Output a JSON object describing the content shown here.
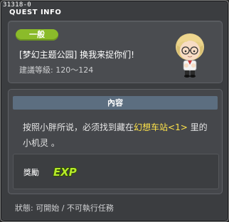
{
  "window": {
    "quest_id": "31318-0",
    "title": "QUEST INFO"
  },
  "summary": {
    "category_tag": "一般",
    "quest_name": "[梦幻主题公园] 换我来捉你们!",
    "level_text": "建議等級: 120～124",
    "portrait_icon": "npc-portrait-icon"
  },
  "content": {
    "section_title": "內容",
    "desc_before": "按照小胖所说，必须找到藏在",
    "desc_highlight": "幻想车站<1>",
    "desc_after": " 里的小机灵 。",
    "highlight_color": "#ffe44a"
  },
  "reward": {
    "label": "獎勵",
    "exp_icon_text": "EXP",
    "exp_color": "#b6ea2a"
  },
  "status": {
    "text": "狀態:  可開始 / 不可執行任務"
  }
}
